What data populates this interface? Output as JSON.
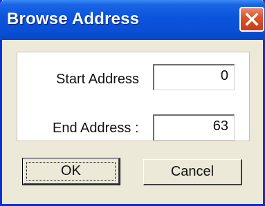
{
  "window": {
    "title": "Browse Address",
    "close_icon": "close-icon"
  },
  "fields": {
    "start": {
      "label": "Start Address",
      "value": "0"
    },
    "end": {
      "label": "End Address :",
      "value": "63"
    }
  },
  "buttons": {
    "ok_label": "OK",
    "cancel_label": "Cancel"
  },
  "colors": {
    "titlebar": "#0a54dc",
    "close_button": "#d9542e",
    "dialog_background": "#ece9d8",
    "panel_background": "#ffffff"
  }
}
